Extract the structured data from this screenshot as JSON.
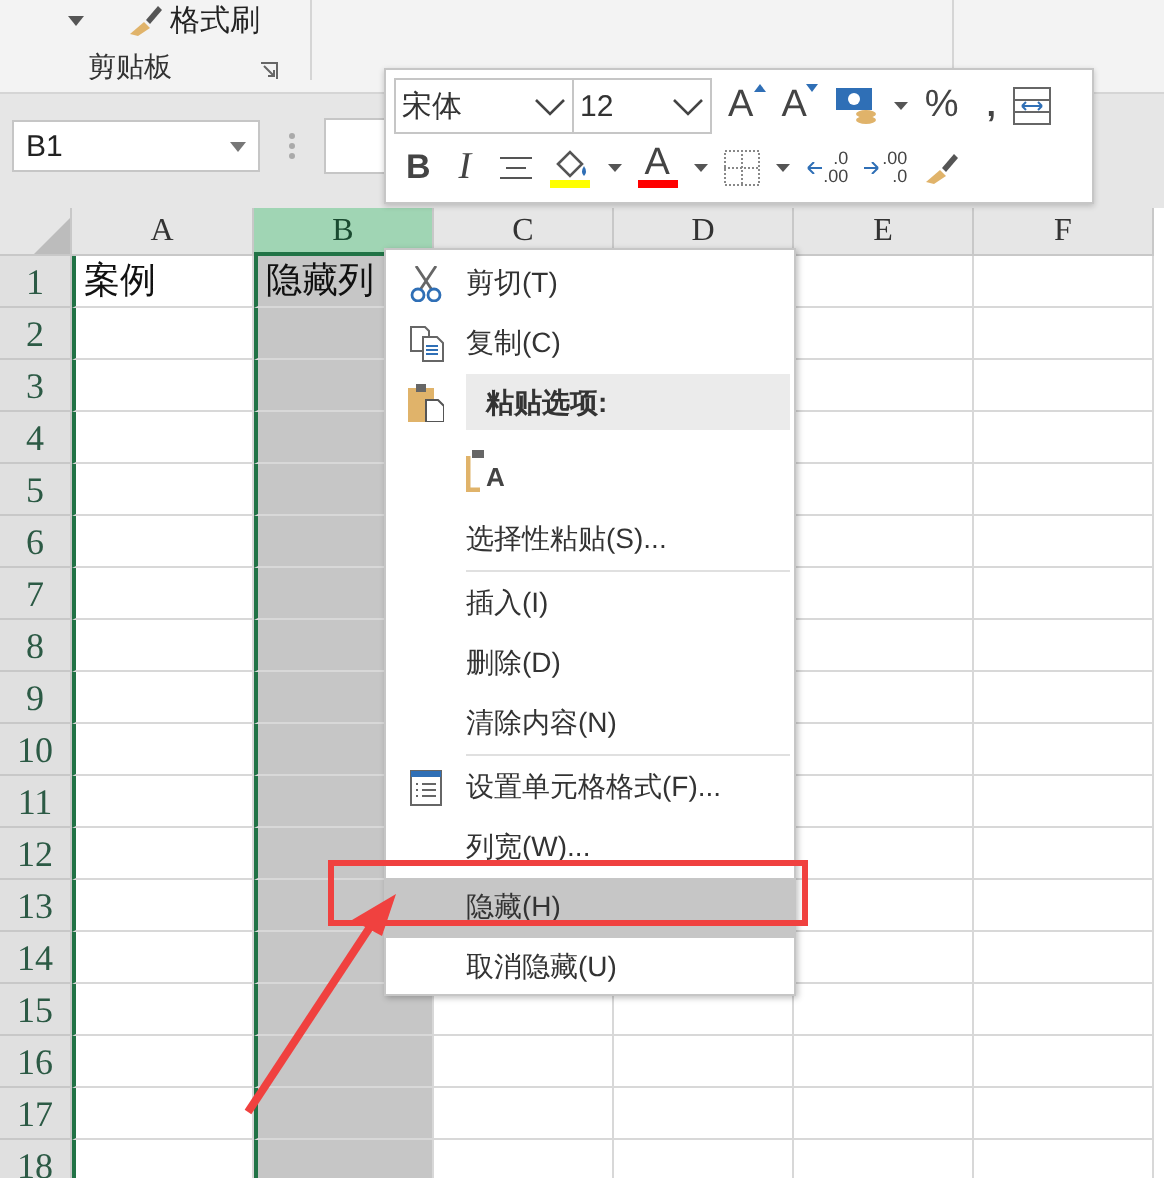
{
  "ribbon": {
    "format_painter": "格式刷",
    "group_label": "剪贴板"
  },
  "formula_bar": {
    "name_box": "B1"
  },
  "mini_toolbar": {
    "font": "宋体",
    "size": "12",
    "grow_font": "A",
    "shrink_font": "A",
    "percent": "%",
    "comma": ",",
    "bold": "B",
    "italic": "I",
    "font_color": "A",
    "increase_decimal": [
      ".0",
      ".00"
    ],
    "decrease_decimal": [
      ".00",
      ".0"
    ]
  },
  "columns": [
    {
      "label": "A",
      "selected": false
    },
    {
      "label": "B",
      "selected": true
    },
    {
      "label": "C",
      "selected": false
    },
    {
      "label": "D",
      "selected": false
    },
    {
      "label": "E",
      "selected": false
    },
    {
      "label": "F",
      "selected": false
    }
  ],
  "rows": [
    {
      "label": "1",
      "cells": [
        "案例",
        "隐藏列"
      ]
    },
    {
      "label": "2"
    },
    {
      "label": "3"
    },
    {
      "label": "4"
    },
    {
      "label": "5"
    },
    {
      "label": "6"
    },
    {
      "label": "7"
    },
    {
      "label": "8"
    },
    {
      "label": "9"
    },
    {
      "label": "10"
    },
    {
      "label": "11"
    },
    {
      "label": "12"
    },
    {
      "label": "13"
    },
    {
      "label": "14"
    },
    {
      "label": "15"
    },
    {
      "label": "16"
    },
    {
      "label": "17"
    },
    {
      "label": "18"
    }
  ],
  "context_menu": [
    {
      "kind": "item",
      "label": "剪切(T)",
      "selected": false
    },
    {
      "kind": "item",
      "label": "复制(C)",
      "selected": false
    },
    {
      "kind": "header",
      "label": "粘贴选项:"
    },
    {
      "kind": "paste-option",
      "letter": "A"
    },
    {
      "kind": "item",
      "label": "选择性粘贴(S)...",
      "selected": false
    },
    {
      "kind": "separator"
    },
    {
      "kind": "item",
      "label": "插入(I)",
      "selected": false
    },
    {
      "kind": "item",
      "label": "删除(D)",
      "selected": false
    },
    {
      "kind": "item",
      "label": "清除内容(N)",
      "selected": false
    },
    {
      "kind": "separator"
    },
    {
      "kind": "item",
      "label": "设置单元格格式(F)...",
      "selected": false
    },
    {
      "kind": "item",
      "label": "列宽(W)...",
      "selected": false
    },
    {
      "kind": "item",
      "label": "隐藏(H)",
      "selected": true
    },
    {
      "kind": "item",
      "label": "取消隐藏(U)",
      "selected": false
    }
  ]
}
